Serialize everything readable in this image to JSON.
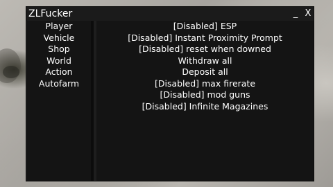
{
  "window": {
    "title": "ZLFucker",
    "minimize_label": "_",
    "close_label": "X"
  },
  "sidebar": {
    "items": [
      {
        "label": "Player"
      },
      {
        "label": "Vehicle"
      },
      {
        "label": "Shop"
      },
      {
        "label": "World"
      },
      {
        "label": "Action"
      },
      {
        "label": "Autofarm"
      }
    ]
  },
  "main": {
    "items": [
      {
        "label": "[Disabled] ESP"
      },
      {
        "label": "[Disabled] Instant Proximity Prompt"
      },
      {
        "label": "[Disabled] reset when downed"
      },
      {
        "label": "Withdraw all"
      },
      {
        "label": "Deposit all"
      },
      {
        "label": "[Disabled] max firerate"
      },
      {
        "label": "[Disabled] mod guns"
      },
      {
        "label": "[Disabled] Infinite Magazines"
      }
    ]
  },
  "colors": {
    "panel_bg": "#141414",
    "window_bg": "#1e1e1e",
    "text": "#ffffff"
  }
}
